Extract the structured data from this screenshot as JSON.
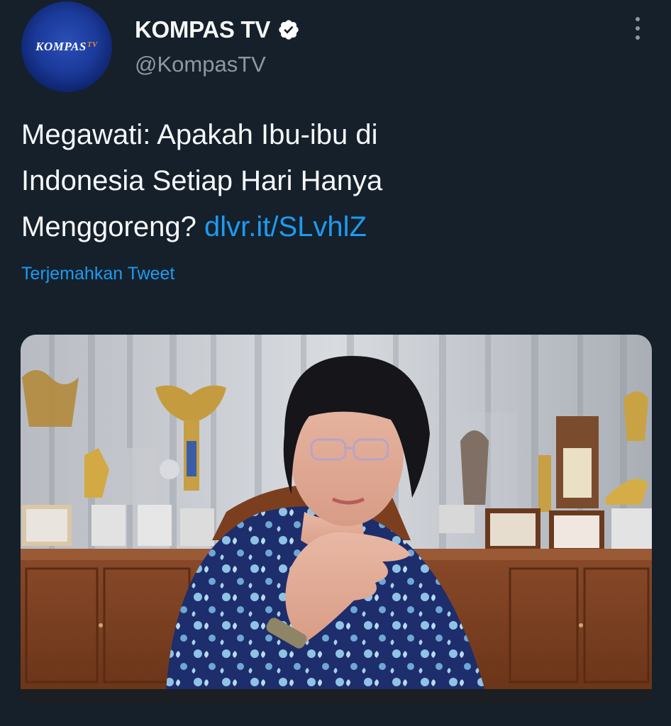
{
  "account": {
    "display_name": "KOMPAS TV",
    "handle": "@KompasTV",
    "avatar_text": "KOMPAS",
    "avatar_suffix": "TV",
    "verified": true
  },
  "tweet": {
    "text_line_1": "Megawati: Apakah Ibu-ibu di",
    "text_line_2": "Indonesia Setiap Hari Hanya",
    "text_line_3": "Menggoreng?",
    "link": "dlvr.it/SLvhlZ",
    "translate_label": "Terjemahkan Tweet"
  },
  "media": {
    "type": "photo",
    "icon": "photo-icon"
  },
  "colors": {
    "background": "#15202b",
    "text_primary": "#f7f9f9",
    "text_secondary": "#8b98a5",
    "link": "#1d9bf0",
    "avatar_blue": "#1b3a9a"
  },
  "icons": {
    "verified": "verified-badge-icon",
    "more": "more-options-icon"
  }
}
